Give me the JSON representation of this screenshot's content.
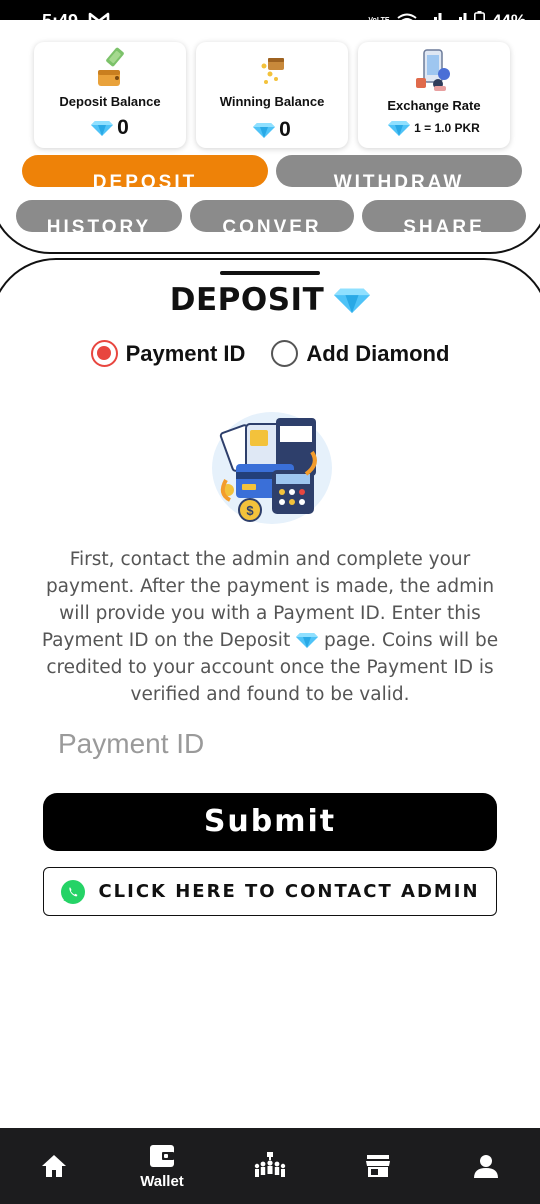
{
  "status_bar": {
    "time": "5:49",
    "network_label": "VoLTE",
    "battery": "44%"
  },
  "wallet": {
    "deposit_balance": {
      "title": "Deposit Balance",
      "value": "0"
    },
    "winning_balance": {
      "title": "Winning Balance",
      "value": "0"
    },
    "exchange_rate": {
      "title": "Exchange Rate",
      "value": "1 = 1.0 PKR"
    }
  },
  "tabs": {
    "deposit": "DEPOSIT",
    "withdraw": "WITHDRAW",
    "history": "HISTORY",
    "convert": "CONVER",
    "share": "SHARE"
  },
  "deposit_sheet": {
    "title": "DEPOSIT",
    "options": {
      "payment_id": "Payment ID",
      "add_diamond": "Add Diamond",
      "selected": "payment_id"
    },
    "description_part1": "First, contact the admin and complete your payment. After the payment is made, the admin will provide you with a Payment ID. Enter this Payment ID on the Deposit",
    "description_part2": "page. Coins will be credited to your account once the Payment ID is verified and found to be valid.",
    "payment_placeholder": "Payment ID",
    "submit_label": "Submit",
    "contact_label": "CLICK HERE TO CONTACT ADMIN"
  },
  "bottom_nav": {
    "wallet_label": "Wallet",
    "active": "wallet"
  },
  "colors": {
    "accent_orange": "#ee8208",
    "radio_red": "#e8463f",
    "tab_gray": "#8b8b8b",
    "diamond_blue": "#4fc3f7",
    "whatsapp_green": "#25d366"
  }
}
